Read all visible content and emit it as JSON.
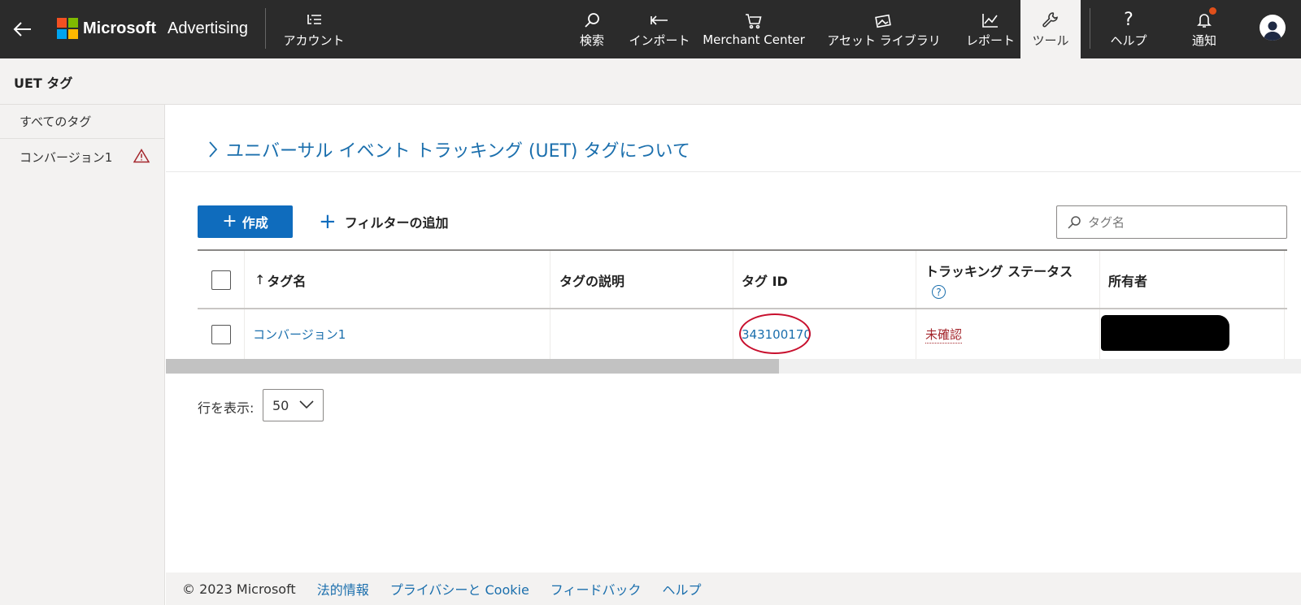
{
  "brand": {
    "company": "Microsoft",
    "product": "Advertising",
    "logo_colors": [
      "#f25022",
      "#7fba00",
      "#00a4ef",
      "#ffb900"
    ]
  },
  "nav": {
    "account": "アカウント",
    "search": "検索",
    "import": "インポート",
    "merchant": "Merchant Center",
    "assets": "アセット ライブラリ",
    "reports": "レポート",
    "tools": "ツール",
    "help": "ヘルプ",
    "notifications": "通知"
  },
  "page": {
    "title": "UET タグ"
  },
  "sidebar": {
    "items": [
      {
        "label": "すべてのタグ"
      },
      {
        "label": "コンバージョン1"
      }
    ]
  },
  "main": {
    "about_link": "ユニバーサル イベント トラッキング (UET) タグについて",
    "create_label": "作成",
    "add_filter_label": "フィルターの追加",
    "search_placeholder": "タグ名"
  },
  "table": {
    "headers": {
      "name": "タグ名",
      "description": "タグの説明",
      "id": "タグ ID",
      "status": "トラッキング ステータス",
      "owner": "所有者"
    },
    "rows": [
      {
        "name": "コンバージョン1",
        "description": "",
        "id": "343100170",
        "status": "未確認",
        "owner": ""
      }
    ]
  },
  "pagination": {
    "rows_label": "行を表示:",
    "rows_value": "50"
  },
  "footer": {
    "copyright": "© 2023 Microsoft",
    "links": [
      "法的情報",
      "プライバシーと Cookie",
      "フィードバック",
      "ヘルプ"
    ]
  },
  "colors": {
    "topbar": "#2b2b2b",
    "accent": "#0f6cbd",
    "link": "#1b6fad",
    "status_unverified": "#a4262c",
    "annotation_circle": "#c8102e"
  },
  "scroll": {
    "horizontal_visible_fraction": 0.54
  }
}
